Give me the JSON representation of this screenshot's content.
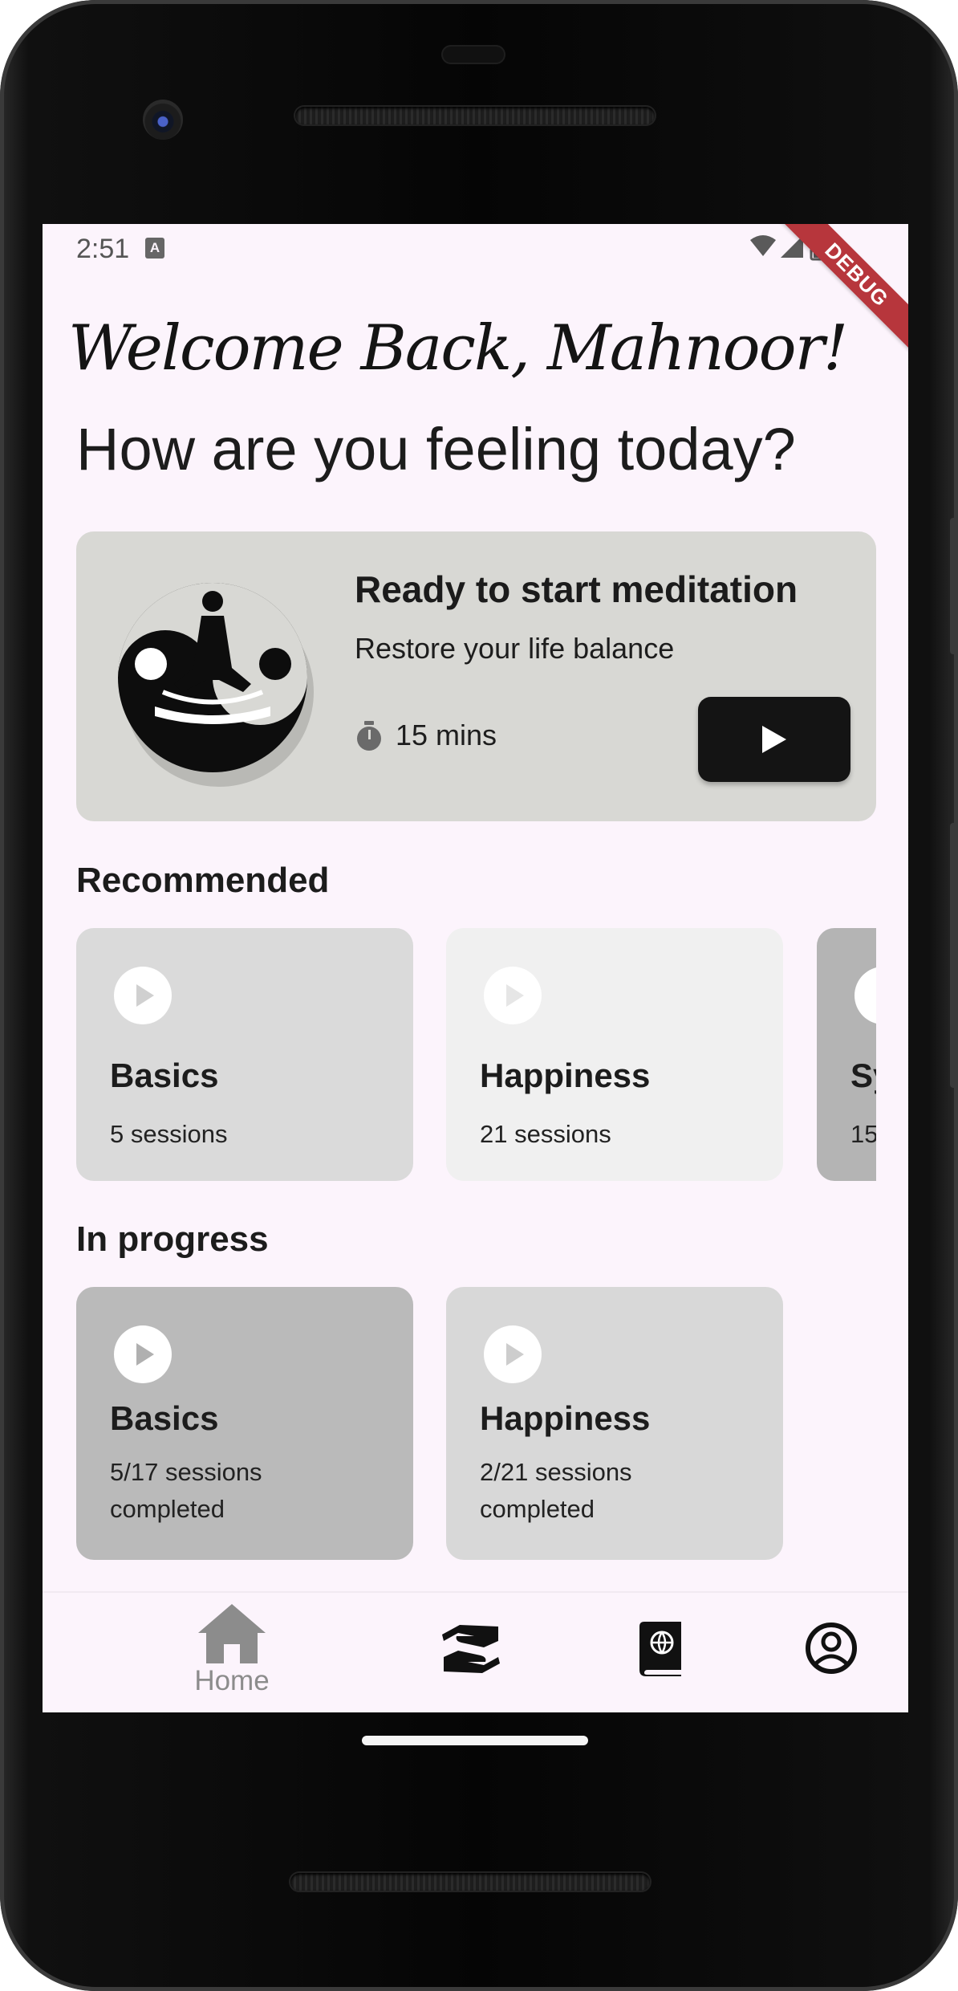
{
  "status_bar": {
    "time": "2:51",
    "notification_glyph": "A"
  },
  "debug_banner": "DEBUG",
  "greeting": "Welcome Back, Mahnoor!",
  "headline": "How are you feeling today?",
  "hero": {
    "title": "Ready to start meditation",
    "subtitle": "Restore your life balance",
    "duration": "15 mins",
    "play_icon": "play-icon",
    "timer_icon": "timer-icon"
  },
  "recommended": {
    "title": "Recommended",
    "cards": [
      {
        "title": "Basics",
        "subtitle": "5 sessions",
        "color": "#dadada"
      },
      {
        "title": "Happiness",
        "subtitle": "21 sessions",
        "color": "#f0f0f0"
      },
      {
        "title": "Sy",
        "subtitle": "15",
        "color": "#b4b4b4"
      }
    ]
  },
  "in_progress": {
    "title": "In progress",
    "cards": [
      {
        "title": "Basics",
        "subtitle": "5/17 sessions completed",
        "color": "#bababa"
      },
      {
        "title": "Happiness",
        "subtitle": "2/21 sessions completed",
        "color": "#d8d8d8"
      }
    ]
  },
  "bottom_nav": {
    "items": [
      {
        "label": "Home",
        "icon": "home-icon",
        "active": true
      },
      {
        "label": "",
        "icon": "hands-icon",
        "active": false
      },
      {
        "label": "",
        "icon": "book-icon",
        "active": false
      },
      {
        "label": "",
        "icon": "profile-icon",
        "active": false
      }
    ]
  },
  "colors": {
    "screen_bg": "#fcf4fc",
    "hero_bg": "#d8d8d4",
    "play_button": "#141414",
    "nav_active": "#8c8c8c",
    "debug_banner": "#b7363c"
  }
}
